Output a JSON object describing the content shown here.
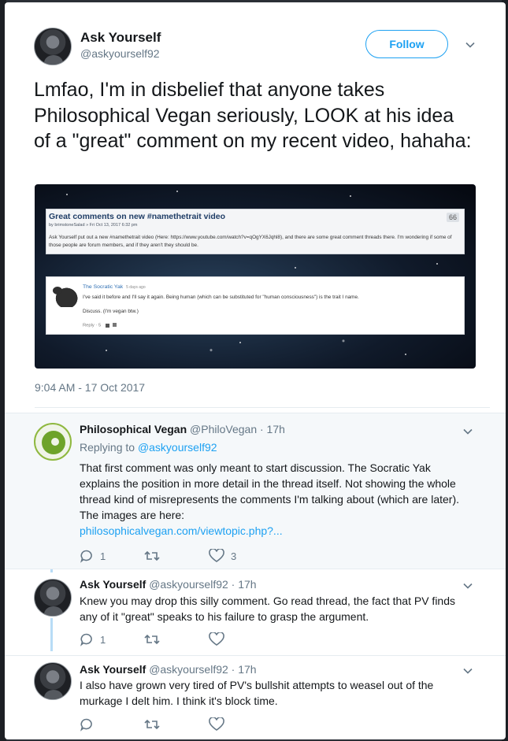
{
  "main_tweet": {
    "name": "Ask Yourself",
    "handle": "@askyourself92",
    "follow_label": "Follow",
    "text": "Lmfao, I'm in disbelief that anyone takes Philosophical Vegan seriously, LOOK at his idea of a \"great\" comment on my recent video, hahaha:",
    "timestamp": "9:04 AM - 17 Oct 2017",
    "image": {
      "post_title": "Great comments on new #namethetrait video",
      "post_meta": "by brimstoneSalad » Fri Oct 13, 2017 6:32 pm",
      "post_body": "Ask Yourself put out a new #namethetrait video (Here: https://www.youtube.com/watch?v=qOgYX6Jqhl8), and there are some great comment threads there. I'm wondering if some of those people are forum members, and if they aren't they should be.",
      "quote_glyph": "66",
      "comment_author": "The Socratic Yak",
      "comment_time": "5 days ago",
      "comment_text": "I've said it before and I'll say it again. Being human (which can be substituted for \"human consciousness\") is the trait I name.",
      "comment_text2": "Discuss. (I'm vegan btw.)",
      "comment_reply": "Reply · 5"
    }
  },
  "replies": [
    {
      "name": "Philosophical Vegan",
      "handle": "@PhiloVegan · 17h",
      "replying_prefix": "Replying to",
      "replying_to": "@askyourself92",
      "text": "That first comment was only meant to start discussion. The Socratic Yak explains the position in more detail in the thread itself.  Not showing the whole thread kind of misrepresents the comments I'm talking about (which are later).\nThe images are here:",
      "link": "philosophicalvegan.com/viewtopic.php?...",
      "reply_count": "1",
      "retweet_count": "",
      "like_count": "3"
    },
    {
      "name": "Ask Yourself",
      "handle": "@askyourself92 · 17h",
      "text": "Knew you may drop this silly comment.  Go read thread, the fact that PV finds any of it \"great\" speaks to his failure to grasp the argument.",
      "reply_count": "1",
      "retweet_count": "",
      "like_count": ""
    },
    {
      "name": "Ask Yourself",
      "handle": "@askyourself92 · 17h",
      "text": "I also have grown very tired of PV's bullshit attempts to weasel out of the murkage I delt him.  I think it's block time.",
      "reply_count": "",
      "retweet_count": "",
      "like_count": ""
    }
  ],
  "colors": {
    "accent": "#1da1f2",
    "secondary_text": "#657786",
    "thread_line": "#b8dcf6"
  }
}
